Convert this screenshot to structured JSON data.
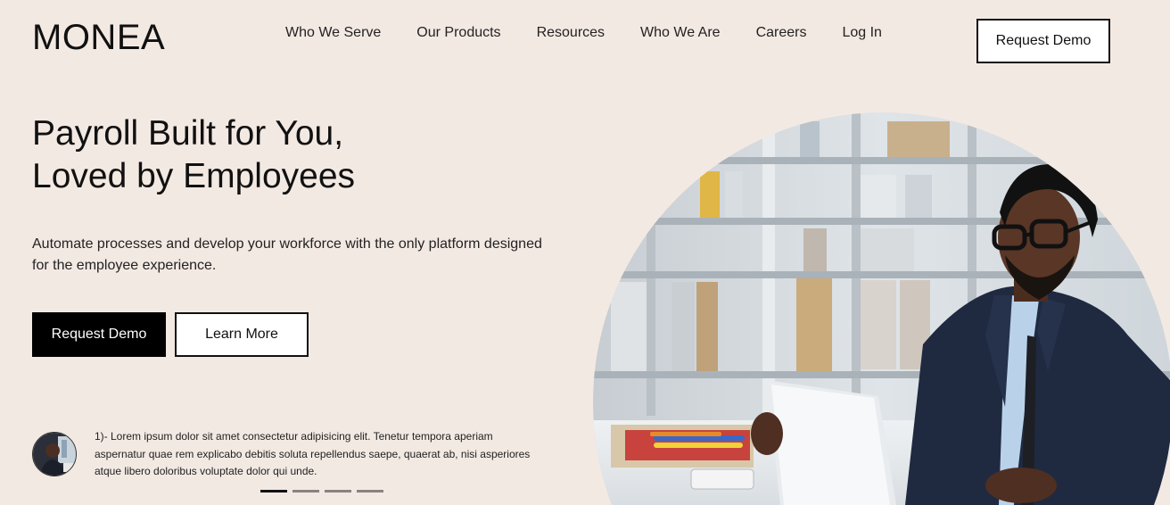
{
  "header": {
    "logo": "MONEA",
    "nav": [
      "Who We Serve",
      "Our Products",
      "Resources",
      "Who We Are",
      "Careers",
      "Log In"
    ],
    "cta_label": "Request Demo"
  },
  "hero": {
    "title_line1": "Payroll Built for You,",
    "title_line2": "Loved by Employees",
    "subtitle": "Automate processes and develop your workforce with the only platform designed for the employee experience.",
    "primary_label": "Request Demo",
    "secondary_label": "Learn More"
  },
  "testimonial": {
    "text": "1)- Lorem ipsum dolor sit amet consectetur adipisicing elit. Tenetur tempora aperiam aspernatur quae rem explicabo debitis soluta repellendus saepe, quaerat ab, nisi asperiores atque libero doloribus voluptate dolor qui unde.",
    "slides": 4,
    "active_slide": 1
  },
  "colors": {
    "background": "#f3e9e3",
    "primary_button": "#000000",
    "accent_text": "#111111"
  }
}
